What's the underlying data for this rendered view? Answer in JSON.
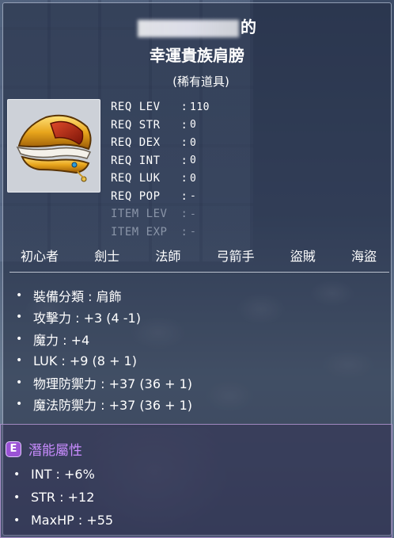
{
  "item": {
    "name_suffix": "的",
    "name": "幸運貴族肩膀",
    "rarity": "(稀有道具)",
    "icon": "gold-shoulder-pad-icon"
  },
  "requirements": [
    {
      "label": "REQ LEV",
      "value": "110"
    },
    {
      "label": "REQ STR",
      "value": "0"
    },
    {
      "label": "REQ DEX",
      "value": "0"
    },
    {
      "label": "REQ INT",
      "value": "0"
    },
    {
      "label": "REQ LUK",
      "value": "0"
    },
    {
      "label": "REQ POP",
      "value": "-"
    },
    {
      "label": "ITEM LEV",
      "value": "-"
    },
    {
      "label": "ITEM EXP",
      "value": "-"
    }
  ],
  "jobs": [
    "初心者",
    "劍士",
    "法師",
    "弓箭手",
    "盜賊",
    "海盜"
  ],
  "stats": [
    "裝備分類 : 肩飾",
    "攻擊力 : +3 (4 -1)",
    "魔力 : +4",
    "LUK : +9 (8 + 1)",
    "物理防禦力 : +37 (36 + 1)",
    "魔法防禦力 : +37 (36 + 1)"
  ],
  "potential": {
    "badge": "E",
    "title": "潛能屬性",
    "lines": [
      "INT : +6%",
      "STR : +12",
      "MaxHP : +55"
    ]
  },
  "colors": {
    "potential_title": "#c98cff",
    "potential_badge": "#9b53d6",
    "dim_text": "#8a95a8"
  },
  "bullet": "•"
}
